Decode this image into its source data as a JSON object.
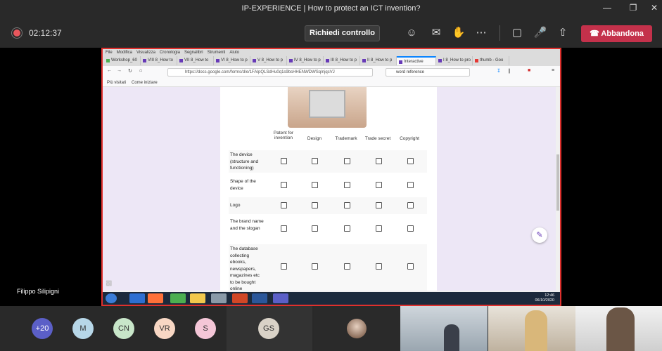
{
  "window": {
    "title": "IP-EXPERIENCE | How to protect an ICT invention?"
  },
  "meeting": {
    "timer": "02:12:37",
    "control_button": "Richiedi controllo",
    "leave_button": "Abbandona",
    "presenter_name": "Filippo Silipigni",
    "icons": [
      "people-icon",
      "chat-icon",
      "raise-hand-icon",
      "more-icon",
      "camera-off-icon",
      "mic-off-icon",
      "share-icon"
    ]
  },
  "browser": {
    "menu": [
      "File",
      "Modifica",
      "Visualizza",
      "Cronologia",
      "Segnalibri",
      "Strumenti",
      "Aiuto"
    ],
    "tabs": [
      "Workshop_60",
      "VIII 8_How to",
      "VII 8_How to",
      "VI 8_How to p",
      "V 8_How to p",
      "IV 8_How to p",
      "III 8_How to p",
      "II 8_How to p",
      "Interactive",
      "I 8_How to pro",
      "thumb - Goo"
    ],
    "active_tab_index": 8,
    "url": "https://docs.google.com/forms/d/e/1FAIpQLSdHu0q1s9bsHHENWDWSq/njqcVJ",
    "search": "word reference",
    "bookmarks": [
      "Più visitati",
      "Come iniziare"
    ]
  },
  "form": {
    "columns": [
      "Patent for invention",
      "Design",
      "Trademark",
      "Trade secret",
      "Copyright"
    ],
    "rows": [
      "The device (structure and functioning)",
      "Shape of the device",
      "Logo",
      "The brand name and the slogan",
      "The database collecting ebooks, newspapers, magazines etc to be bought online"
    ]
  },
  "taskbar": {
    "time": "12:46",
    "date": "06/10/2020"
  },
  "gallery": {
    "avatars": [
      {
        "initials": "+20",
        "color": "#5b5fc7"
      },
      {
        "initials": "M",
        "color": "#b7d7e8"
      },
      {
        "initials": "CN",
        "color": "#c8e6c9"
      },
      {
        "initials": "VR",
        "color": "#f8d7c4"
      },
      {
        "initials": "S",
        "color": "#f4c6d7"
      },
      {
        "initials": "GS",
        "color": "#d9d2c7"
      }
    ]
  }
}
